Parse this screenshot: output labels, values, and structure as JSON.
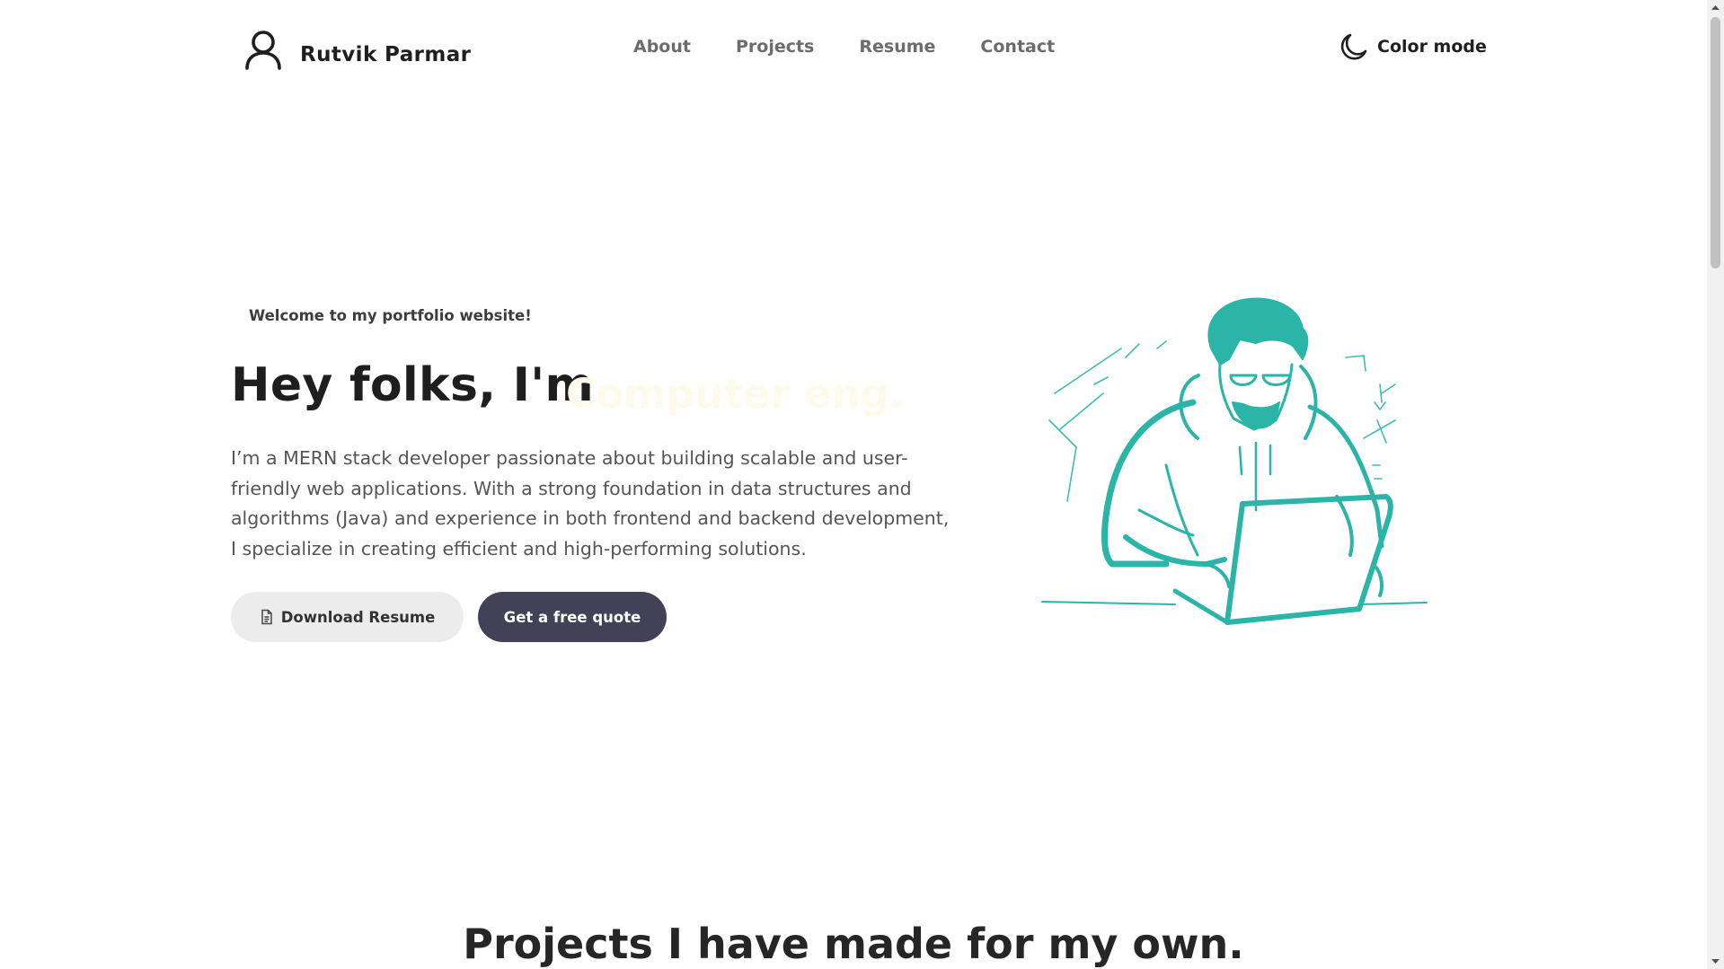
{
  "brand": {
    "name": "Rutvik Parmar",
    "icon": "user-icon"
  },
  "nav": {
    "items": [
      {
        "label": "About"
      },
      {
        "label": "Projects"
      },
      {
        "label": "Resume"
      },
      {
        "label": "Contact"
      }
    ],
    "color_mode_label": "Color mode",
    "color_mode_icon": "moon-icon"
  },
  "hero": {
    "welcome": "Welcome to my portfolio website!",
    "title": "Hey folks, I'm",
    "typed_text": "Computer eng.",
    "description": "I’m a MERN stack developer passionate about building scalable and user-friendly web applications. With a strong foundation in data structures and algorithms (Java) and experience in both frontend and backend development, I specialize in creating efficient and high-performing solutions.",
    "download_button": "Download Resume",
    "download_icon": "document-icon",
    "quote_button": "Get a free quote",
    "illustration": "developer-with-laptop-illustration"
  },
  "projects": {
    "title": "Projects I have made for my own."
  },
  "colors": {
    "accent_teal": "#2ab5a8",
    "button_dark": "#434157",
    "button_light": "#ececec",
    "text_dark": "#1e1e1e",
    "text_muted": "#555555"
  }
}
